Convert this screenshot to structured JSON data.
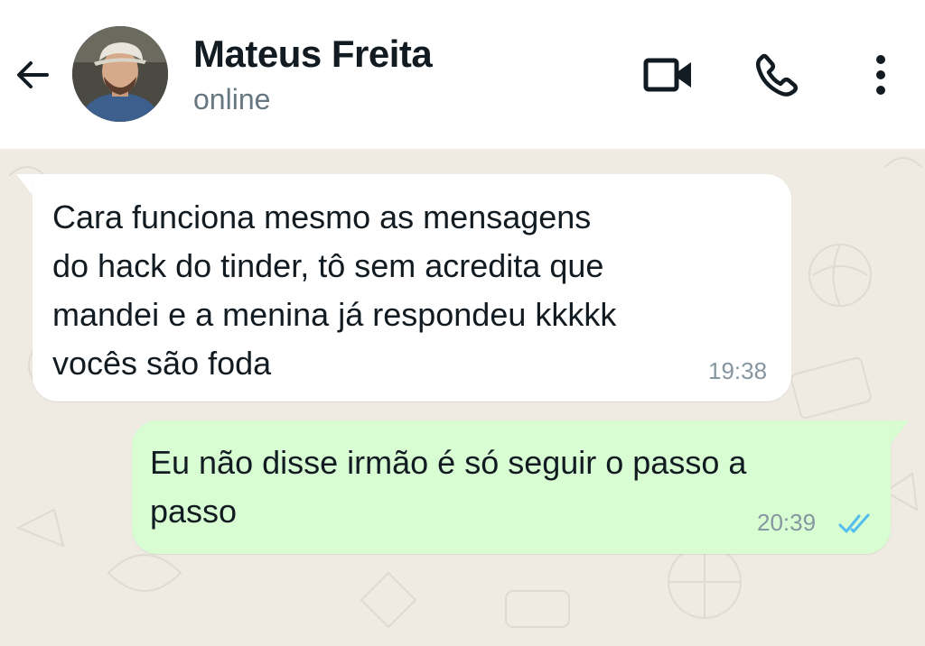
{
  "header": {
    "contact_name": "Mateus Freita",
    "status": "online",
    "icons": {
      "back": "arrow-left-icon",
      "video": "video-camera-icon",
      "call": "phone-icon",
      "menu": "more-vertical-icon"
    }
  },
  "messages": [
    {
      "direction": "incoming",
      "lines": [
        "Cara funciona mesmo as mensagens",
        "do hack do tinder, tô sem acredita que",
        "mandei e a menina já respondeu kkkkk",
        "vocês são foda"
      ],
      "time": "19:38"
    },
    {
      "direction": "outgoing",
      "lines": [
        "Eu não disse irmão é só seguir o passo a",
        "passo"
      ],
      "time": "20:39",
      "status_icon": "double-check-read-icon"
    }
  ],
  "colors": {
    "header_bg": "#ffffff",
    "chat_bg": "#efeae2",
    "incoming_bubble": "#ffffff",
    "outgoing_bubble": "#d9fdd3",
    "read_ticks": "#53bdeb",
    "timestamp": "#8696a0",
    "status_text": "#667781"
  }
}
